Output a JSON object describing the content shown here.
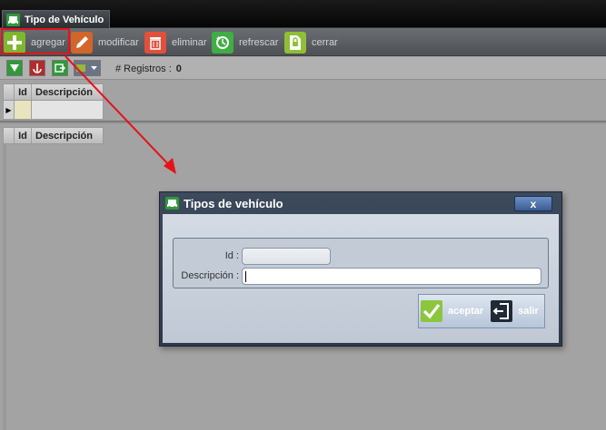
{
  "window": {
    "tab_title": "Tipo de Vehículo"
  },
  "toolbar": {
    "buttons": [
      {
        "label": "agregar",
        "icon": "plus-icon",
        "color": "#7fb62f"
      },
      {
        "label": "modificar",
        "icon": "pencil-icon",
        "color": "#d2652b"
      },
      {
        "label": "eliminar",
        "icon": "trash-icon",
        "color": "#e2503b"
      },
      {
        "label": "refrescar",
        "icon": "refresh-icon",
        "color": "#3fae45"
      },
      {
        "label": "cerrar",
        "icon": "close-document-icon",
        "color": "#8fbf35"
      }
    ]
  },
  "toolbar2": {
    "records_label": "# Registros :",
    "records_count": "0"
  },
  "grid_top": {
    "columns": [
      "Id",
      "Descripción"
    ]
  },
  "grid_bottom": {
    "columns": [
      "Id",
      "Descripción"
    ]
  },
  "dialog": {
    "title": "Tipos de vehículo",
    "close_label": "x",
    "id_label": "Id :",
    "id_value": "",
    "descripcion_label": "Descripción :",
    "descripcion_value": "",
    "accept_label": "aceptar",
    "exit_label": "salir"
  },
  "colors": {
    "highlight": "#e4131a",
    "accent": "#3b5d94"
  }
}
